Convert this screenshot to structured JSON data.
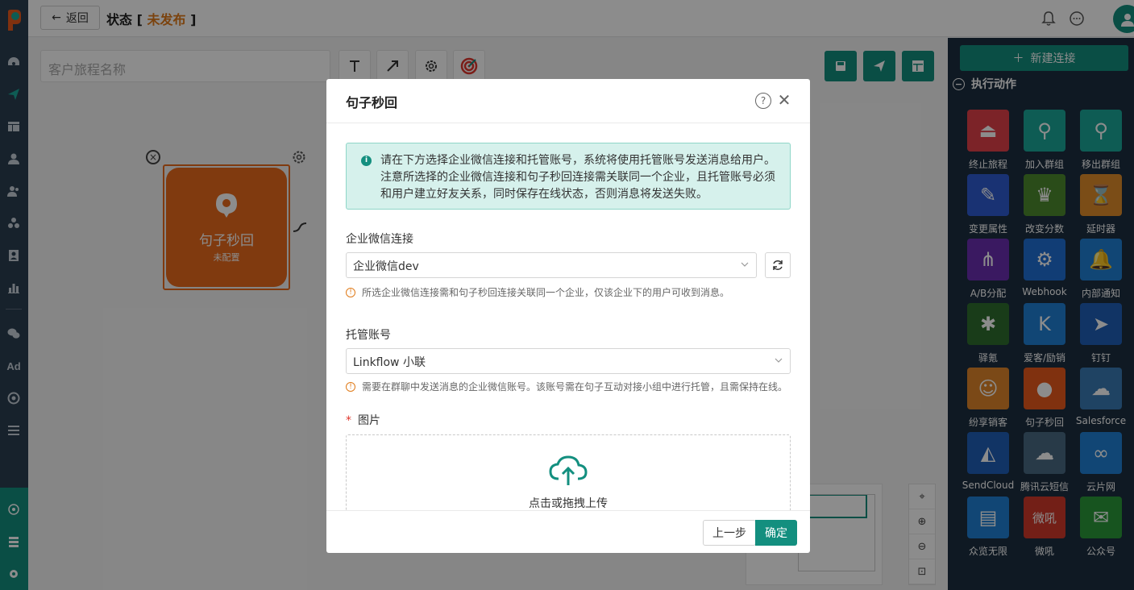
{
  "header": {
    "back_label": "返回",
    "status_prefix": "状态 [",
    "status_value": "未发布",
    "status_suffix": "]"
  },
  "leftnav": {
    "ad_label": "Ad"
  },
  "canvas": {
    "journey_name_placeholder": "客户旅程名称",
    "node": {
      "title": "句子秒回",
      "subtitle": "未配置"
    }
  },
  "rightpanel": {
    "new_connection_label": "新建连接",
    "section_title": "执行动作",
    "tiles": [
      {
        "label": "终止旅程",
        "color": "#e2404a",
        "icon": "stop-icon"
      },
      {
        "label": "加入群组",
        "color": "#1aa89a",
        "icon": "add-user-icon"
      },
      {
        "label": "移出群组",
        "color": "#1aa89a",
        "icon": "remove-user-icon"
      },
      {
        "label": "变更属性",
        "color": "#2e5bd1",
        "icon": "edit-icon"
      },
      {
        "label": "改变分数",
        "color": "#4e8a2f",
        "icon": "trophy-icon"
      },
      {
        "label": "延时器",
        "color": "#e08c2a",
        "icon": "hourglass-icon"
      },
      {
        "label": "A/B分配",
        "color": "#6a2fb1",
        "icon": "split-icon"
      },
      {
        "label": "Webhook",
        "color": "#1f6fd6",
        "icon": "webhook-icon"
      },
      {
        "label": "内部通知",
        "color": "#1f80d6",
        "icon": "bell-icon"
      },
      {
        "label": "驿氪",
        "color": "#2f6e2f",
        "icon": "spider-icon"
      },
      {
        "label": "爱客/励销",
        "color": "#1f80d6",
        "icon": "k-icon"
      },
      {
        "label": "钉钉",
        "color": "#1f5fb8",
        "icon": "dingtalk-icon"
      },
      {
        "label": "纷享销客",
        "color": "#e0852a",
        "icon": "robot-icon"
      },
      {
        "label": "句子秒回",
        "color": "#e9591c",
        "icon": "chat-icon"
      },
      {
        "label": "Salesforce",
        "color": "#3a7ab5",
        "icon": "cloud-icon"
      },
      {
        "label": "SendCloud",
        "color": "#1f5fb8",
        "icon": "sendcloud-icon"
      },
      {
        "label": "腾讯云短信",
        "color": "#4a6a84",
        "icon": "tencent-cloud-icon"
      },
      {
        "label": "云片网",
        "color": "#1f80d6",
        "icon": "yunpian-icon"
      },
      {
        "label": "众览无限",
        "color": "#1f80d6",
        "icon": "zhonglan-icon"
      },
      {
        "label": "微吼",
        "color": "#d23a2a",
        "icon": "weihou-icon"
      },
      {
        "label": "公众号",
        "color": "#2b9a3a",
        "icon": "wechat-icon"
      }
    ]
  },
  "modal": {
    "title": "句子秒回",
    "info_text": "请在下方选择企业微信连接和托管账号，系统将使用托管账号发送消息给用户。注意所选择的企业微信连接和句子秒回连接需关联同一个企业，且托管账号必须和用户建立好友关系，同时保存在线状态，否则消息将发送失败。",
    "wecom_label": "企业微信连接",
    "wecom_value": "企业微信dev",
    "wecom_hint": "所选企业微信连接需和句子秒回连接关联同一个企业，仅该企业下的用户可收到消息。",
    "account_label": "托管账号",
    "account_value": "Linkflow 小联",
    "account_hint": "需要在群聊中发送消息的企业微信账号。该账号需在句子互动对接小组中进行托管，且需保持在线。",
    "image_label": "图片",
    "upload_text": "点击或拖拽上传",
    "prev_label": "上一步",
    "ok_label": "确定"
  },
  "colors": {
    "brand": "#138f7f",
    "node": "#e96a1c",
    "warning": "#e07b1a"
  }
}
